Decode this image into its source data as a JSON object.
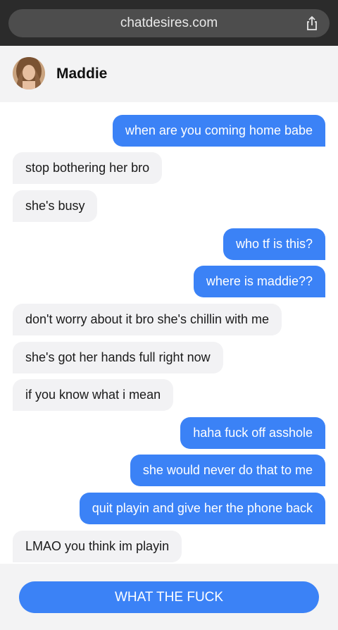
{
  "browser": {
    "url": "chatdesires.com"
  },
  "header": {
    "contact_name": "Maddie"
  },
  "messages": [
    {
      "from": "me",
      "text": "when are you coming home babe"
    },
    {
      "from": "them",
      "text": "stop bothering her bro"
    },
    {
      "from": "them",
      "text": "she's busy"
    },
    {
      "from": "me",
      "text": "who tf is this?"
    },
    {
      "from": "me",
      "text": "where is maddie??"
    },
    {
      "from": "them",
      "text": "don't worry about it bro she's chillin with me"
    },
    {
      "from": "them",
      "text": "she's got her hands full right now"
    },
    {
      "from": "them",
      "text": "if you know what i mean"
    },
    {
      "from": "me",
      "text": "haha fuck off asshole"
    },
    {
      "from": "me",
      "text": "she would never do that to me"
    },
    {
      "from": "me",
      "text": "quit playin and give her the phone back"
    },
    {
      "from": "them",
      "text": "LMAO you think im playin"
    }
  ],
  "footer": {
    "button_label": "WHAT THE FUCK"
  },
  "colors": {
    "outgoing_bubble": "#3b82f6",
    "incoming_bubble": "#f2f2f4",
    "browser_bar": "#2b2b2b"
  }
}
